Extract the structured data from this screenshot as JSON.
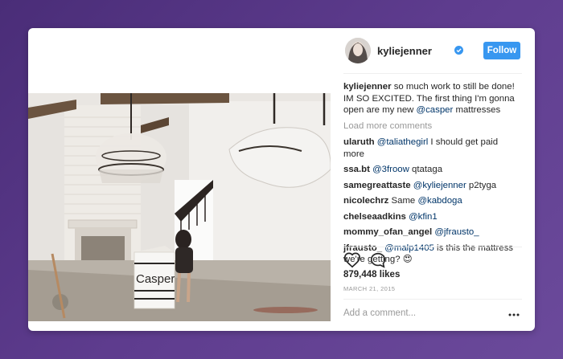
{
  "post": {
    "username": "kyliejenner",
    "follow_label": "Follow",
    "caption": {
      "user": "kyliejenner",
      "text_before": " so much work to still be done! IM SO EXCITED. The first thing I'm gonna open are my new ",
      "mention": "@casper",
      "text_after": " mattresses"
    },
    "load_more": "Load more comments",
    "comments": [
      {
        "user": "ularuth",
        "mention": "@taliathegirl",
        "text": " I should get paid more"
      },
      {
        "user": "ssa.bt",
        "mention": "@3froow",
        "text": " qtataga"
      },
      {
        "user": "samegreattaste",
        "mention": "@kyliejenner",
        "text": " p2tyga"
      },
      {
        "user": "nicolechrz",
        "mention": "",
        "text": " Same ",
        "mention2": "@kabdoga"
      },
      {
        "user": "chelseaadkins",
        "mention": "@kfin1",
        "text": ""
      },
      {
        "user": "mommy_ofan_angel",
        "mention": "@jfrausto_",
        "text": ""
      },
      {
        "user": "jfrausto_",
        "mention": "@malp1405",
        "text": " is this the mattress we're getting? 😍"
      }
    ],
    "likes": "879,448 likes",
    "date": "MARCH 21, 2015",
    "add_comment_placeholder": "Add a comment...",
    "photo_brand_text": "Casper"
  },
  "colors": {
    "follow": "#3897f0",
    "link": "#003569",
    "verified": "#3897f0"
  },
  "icons": [
    "verified-badge-icon",
    "heart-icon",
    "comment-icon",
    "more-options-icon"
  ]
}
